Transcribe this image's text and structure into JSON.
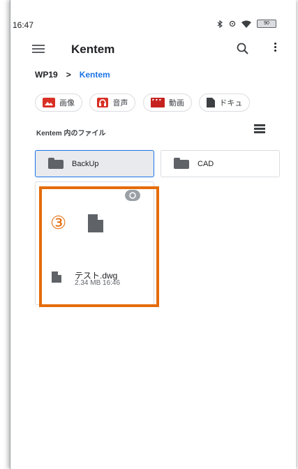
{
  "status_bar": {
    "time": "16:47",
    "battery": "90"
  },
  "app_bar": {
    "title": "Kentem"
  },
  "breadcrumb": {
    "root": "WP19",
    "separator": ">",
    "current": "Kentem"
  },
  "chips": [
    {
      "label": "画像",
      "icon": "image-icon",
      "color": "#d93025"
    },
    {
      "label": "音声",
      "icon": "audio-icon",
      "color": "#d93025"
    },
    {
      "label": "動画",
      "icon": "video-icon",
      "color": "#c5221f"
    },
    {
      "label": "ドキュ",
      "icon": "document-icon",
      "color": "#3c4043"
    }
  ],
  "section": {
    "label": "Kentem 内のファイル"
  },
  "folders": [
    {
      "name": "BackUp",
      "selected": true
    },
    {
      "name": "CAD",
      "selected": false
    }
  ],
  "file": {
    "name": "テスト.dwg",
    "meta": "2.34 MB 16:46"
  },
  "annotation": {
    "number": "③",
    "color": "#e46c0a"
  }
}
